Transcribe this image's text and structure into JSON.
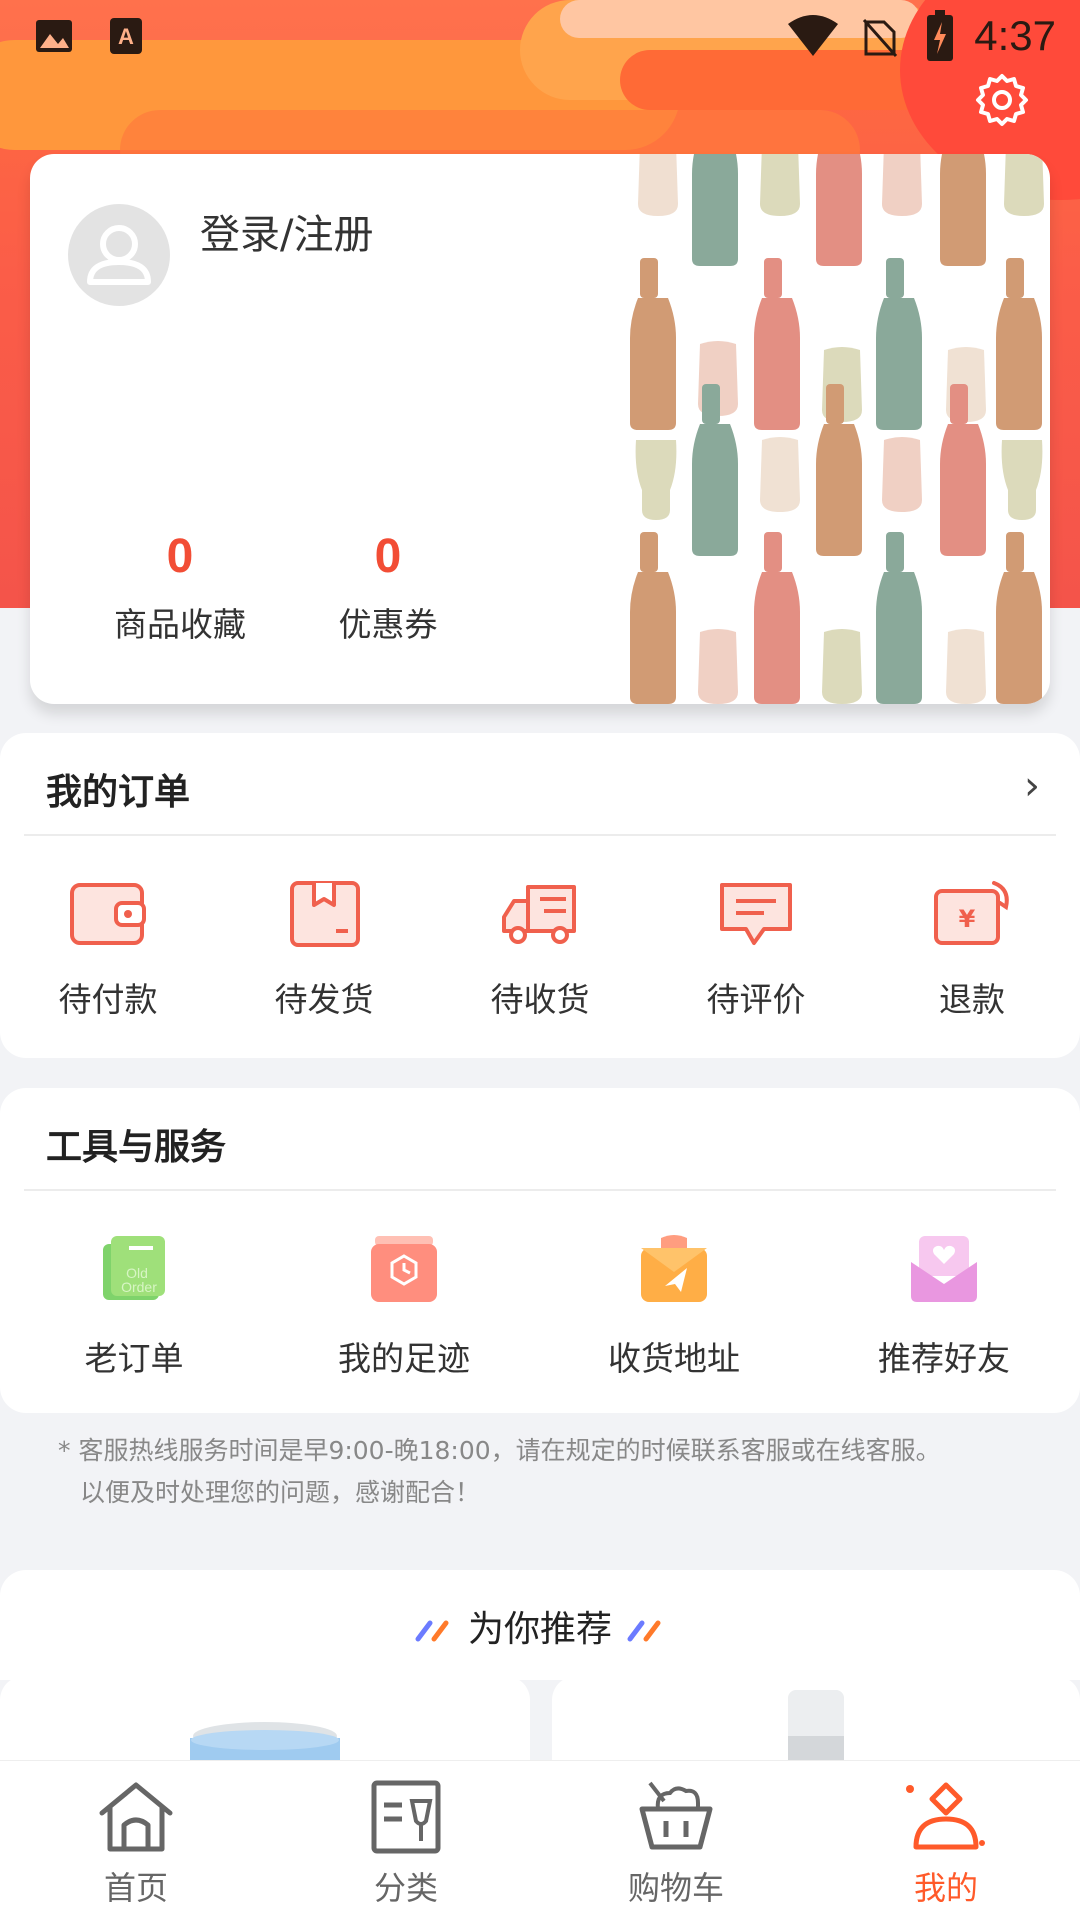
{
  "status_bar": {
    "time": "4:37"
  },
  "profile": {
    "login_label": "登录/注册",
    "stats": [
      {
        "value": "0",
        "label": "商品收藏"
      },
      {
        "value": "0",
        "label": "优惠券"
      }
    ]
  },
  "orders": {
    "title": "我的订单",
    "chevron": "›",
    "items": [
      {
        "label": "待付款",
        "icon": "wallet-icon"
      },
      {
        "label": "待发货",
        "icon": "package-icon"
      },
      {
        "label": "待收货",
        "icon": "delivery-truck-icon"
      },
      {
        "label": "待评价",
        "icon": "comment-icon"
      },
      {
        "label": "退款",
        "icon": "refund-icon"
      }
    ]
  },
  "tools": {
    "title": "工具与服务",
    "items": [
      {
        "label": "老订单",
        "icon": "old-order-icon"
      },
      {
        "label": "我的足迹",
        "icon": "footprint-icon"
      },
      {
        "label": "收货地址",
        "icon": "address-icon"
      },
      {
        "label": "推荐好友",
        "icon": "recommend-friend-icon"
      }
    ]
  },
  "hotline": {
    "line1": "* 客服热线服务时间是早9:00-晚18:00，请在规定的时候联系客服或在线客服。",
    "line2": "以便及时处理您的问题，感谢配合！"
  },
  "recommend": {
    "title": "为你推荐"
  },
  "tabbar": {
    "items": [
      {
        "label": "首页",
        "icon": "home-icon"
      },
      {
        "label": "分类",
        "icon": "category-icon"
      },
      {
        "label": "购物车",
        "icon": "cart-icon"
      },
      {
        "label": "我的",
        "icon": "profile-icon"
      }
    ],
    "active_index": 3
  },
  "colors": {
    "accent": "#f24d35",
    "tab_active": "#ff5a2a",
    "header_gradient_top": "#ff6d3f",
    "header_gradient_bottom": "#f4544a"
  }
}
